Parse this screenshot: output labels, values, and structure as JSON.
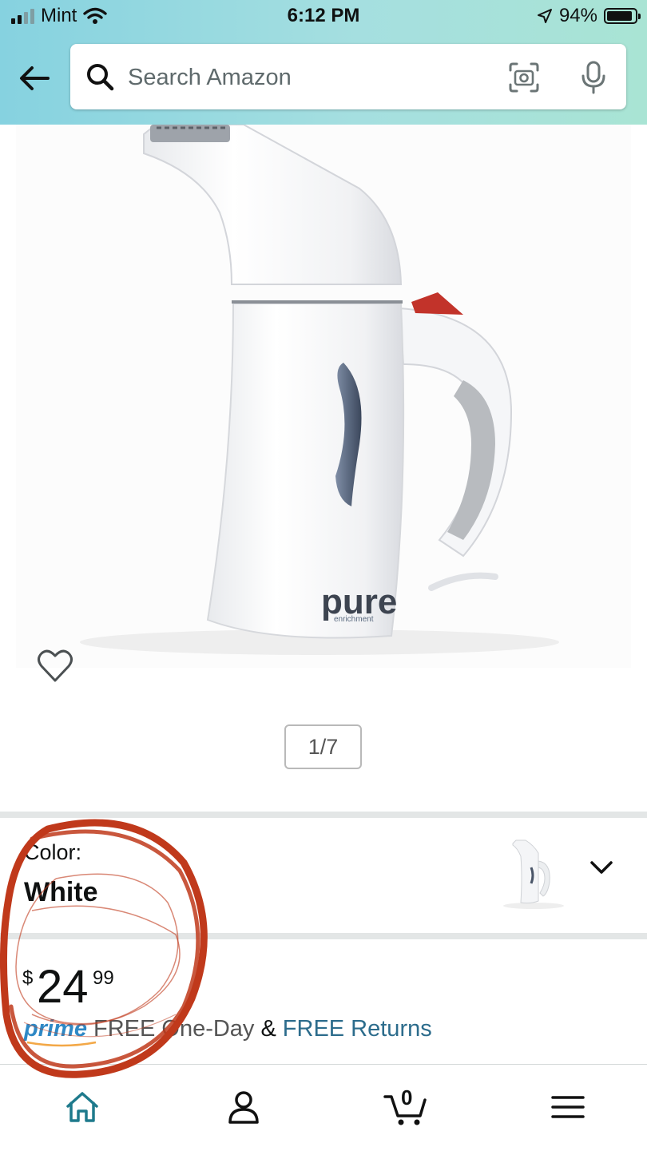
{
  "status_bar": {
    "carrier": "Mint",
    "time": "6:12 PM",
    "battery": "94%"
  },
  "search": {
    "placeholder": "Search Amazon"
  },
  "gallery": {
    "pager": "1/7",
    "brand_logo_text": "pure enrichment"
  },
  "variant": {
    "label": "Color:",
    "value": "White"
  },
  "price": {
    "symbol": "$",
    "whole": "24",
    "fraction": "99"
  },
  "delivery": {
    "prime": "prime",
    "one_day": "FREE One-Day",
    "amp": "&",
    "returns": "FREE Returns"
  },
  "tabbar": {
    "cart_count": "0",
    "items": [
      "home-icon",
      "account-icon",
      "cart-icon",
      "menu-icon"
    ]
  },
  "colors": {
    "header_gradient": [
      "#86d2e0",
      "#a9e4d4"
    ],
    "link": "#2c6c8c",
    "prime": "#2e88c5",
    "annotation": "#c0391b"
  }
}
